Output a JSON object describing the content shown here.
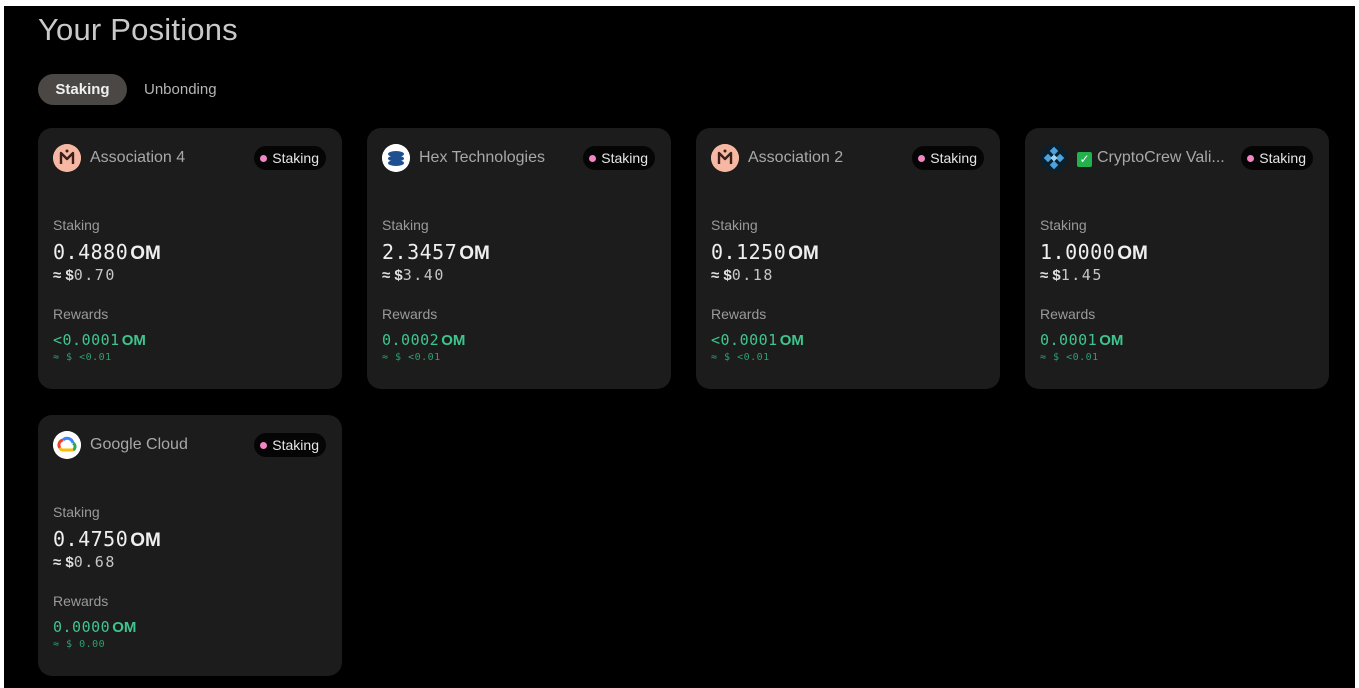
{
  "page": {
    "title": "Your Positions"
  },
  "tabs": [
    {
      "label": "Staking",
      "active": true
    },
    {
      "label": "Unbonding",
      "active": false
    }
  ],
  "colors": {
    "accent_green": "#3ec58e",
    "badge_dot": "#f285c3",
    "card_bg": "#1c1c1c"
  },
  "cards": [
    {
      "name": "Association 4",
      "icon": "mantra-logo-icon",
      "status": "Staking",
      "staking_label": "Staking",
      "amount": "0.4880",
      "unit": "OM",
      "usd_symbol": "≈ $",
      "usd_value": "0.70",
      "rewards_label": "Rewards",
      "reward_amount": "<0.0001",
      "reward_unit": "OM",
      "reward_usd": "≈ $ <0.01"
    },
    {
      "name": "Hex Technologies",
      "icon": "hex-technologies-logo-icon",
      "status": "Staking",
      "staking_label": "Staking",
      "amount": "2.3457",
      "unit": "OM",
      "usd_symbol": "≈ $",
      "usd_value": "3.40",
      "rewards_label": "Rewards",
      "reward_amount": "0.0002",
      "reward_unit": "OM",
      "reward_usd": "≈ $ <0.01"
    },
    {
      "name": "Association 2",
      "icon": "mantra-logo-icon",
      "status": "Staking",
      "staking_label": "Staking",
      "amount": "0.1250",
      "unit": "OM",
      "usd_symbol": "≈ $",
      "usd_value": "0.18",
      "rewards_label": "Rewards",
      "reward_amount": "<0.0001",
      "reward_unit": "OM",
      "reward_usd": "≈ $ <0.01"
    },
    {
      "name": "CryptoCrew Vali...",
      "icon": "cryptocrew-logo-icon",
      "check_icon": "check-mark-icon",
      "status": "Staking",
      "staking_label": "Staking",
      "amount": "1.0000",
      "unit": "OM",
      "usd_symbol": "≈ $",
      "usd_value": "1.45",
      "rewards_label": "Rewards",
      "reward_amount": "0.0001",
      "reward_unit": "OM",
      "reward_usd": "≈ $ <0.01"
    },
    {
      "name": "Google Cloud",
      "icon": "google-cloud-logo-icon",
      "status": "Staking",
      "staking_label": "Staking",
      "amount": "0.4750",
      "unit": "OM",
      "usd_symbol": "≈ $",
      "usd_value": "0.68",
      "rewards_label": "Rewards",
      "reward_amount": "0.0000",
      "reward_unit": "OM",
      "reward_usd": "≈ $ 0.00"
    }
  ]
}
